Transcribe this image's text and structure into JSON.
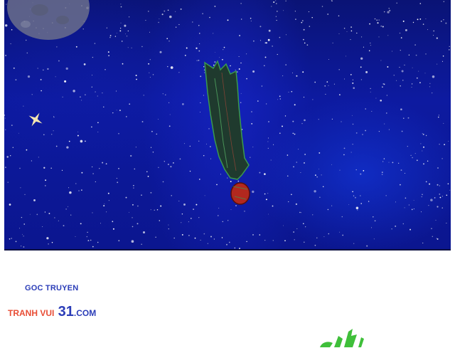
{
  "scene": {
    "colors": {
      "sky": "#0d1aa0",
      "star": "#ffffff",
      "moon": "#6b6f8c",
      "figure": "#1f3a2e",
      "figure_edge": "#3a9a4e",
      "head": "#b2281e"
    },
    "icons": [
      "moon-icon",
      "sparkle-icon"
    ]
  },
  "watermark": {
    "line1": "GOC TRUYEN",
    "site_red": "TRANH VUI ",
    "site_number": "31",
    "site_domain": ".COM",
    "colors": {
      "blue": "#2b3db8",
      "red": "#e84d35"
    }
  },
  "sound_effect": {
    "color": "#3fbf3a"
  }
}
